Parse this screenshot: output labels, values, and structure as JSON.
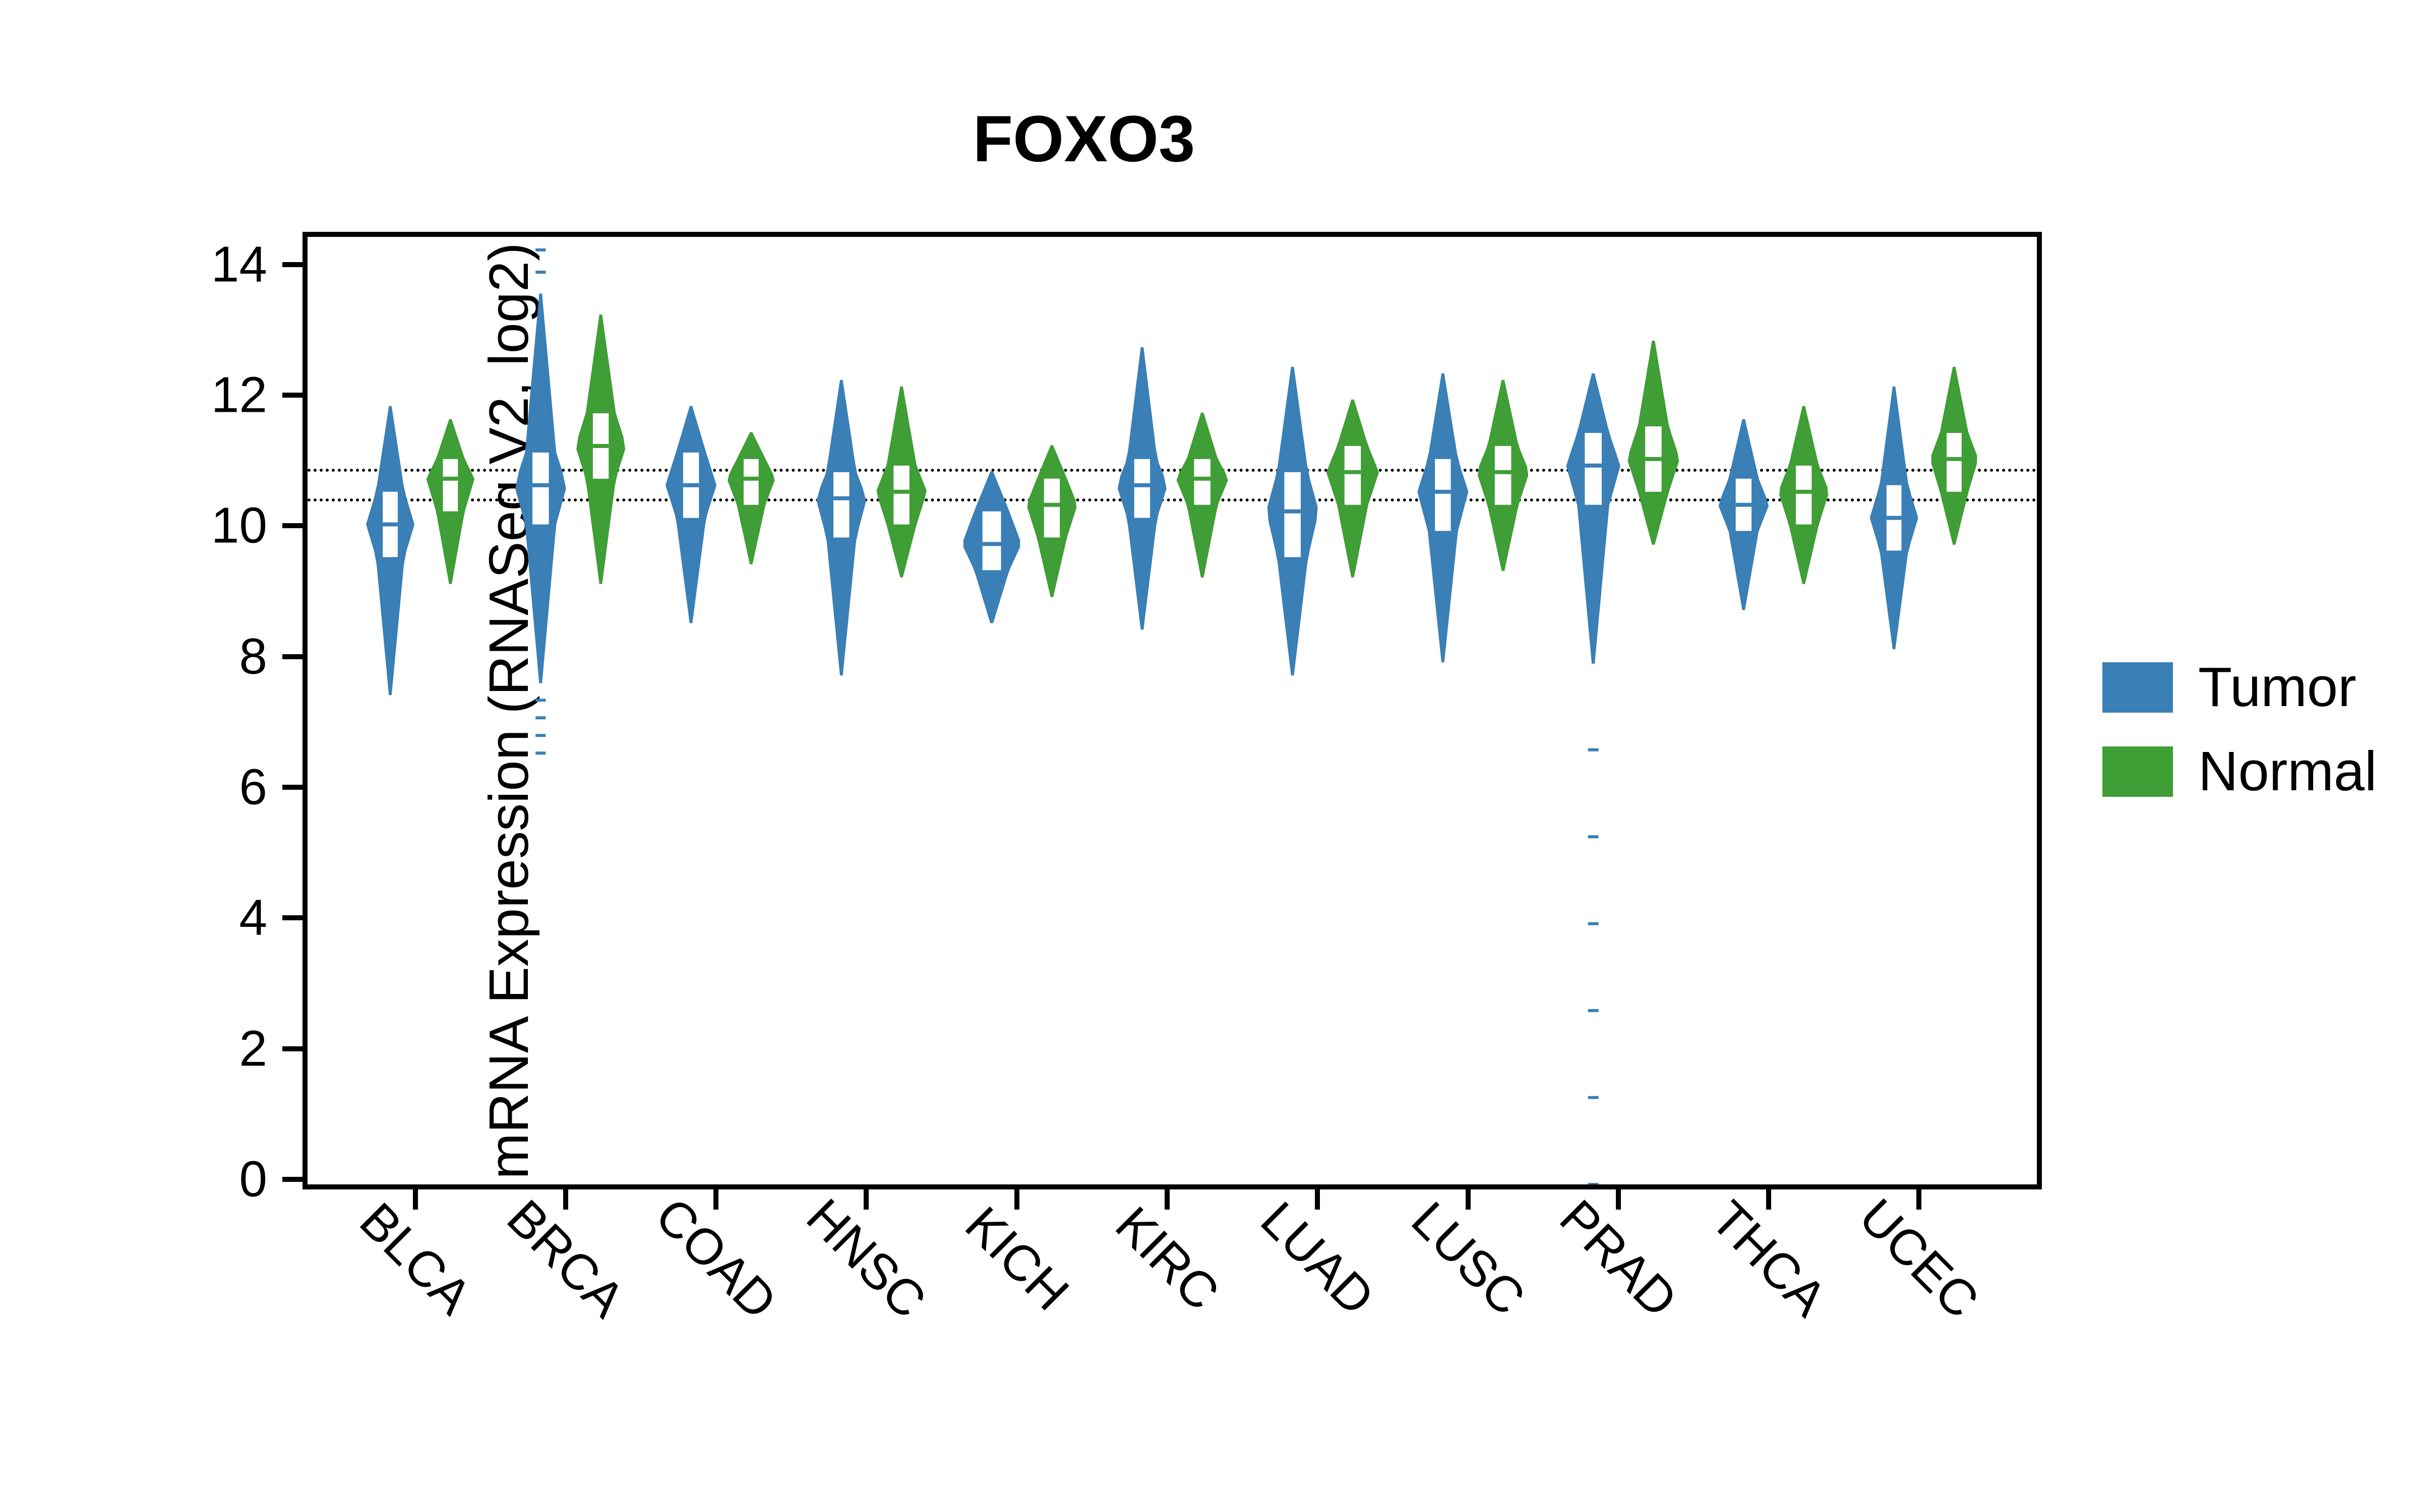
{
  "chart_data": {
    "type": "violin",
    "title": "FOXO3",
    "ylabel": "mRNA Expression (RNASeq V2, log2)",
    "xlabel": "",
    "ylim": [
      0,
      14.5
    ],
    "yticks": [
      0,
      2,
      4,
      6,
      8,
      10,
      12,
      14
    ],
    "reference_lines": [
      10.5,
      10.95
    ],
    "categories": [
      "BLCA",
      "BRCA",
      "COAD",
      "HNSC",
      "KICH",
      "KIRC",
      "LUAD",
      "LUSC",
      "PRAD",
      "THCA",
      "UCEC"
    ],
    "series": [
      {
        "name": "Tumor",
        "color": "#3a7fb5",
        "values": [
          {
            "median": 10.1,
            "q1": 9.6,
            "q3": 10.6,
            "min": 7.5,
            "max": 11.9,
            "width": 0.55
          },
          {
            "median": 10.7,
            "q1": 10.1,
            "q3": 11.2,
            "min": 6.6,
            "max": 14.3,
            "width": 0.6
          },
          {
            "median": 10.7,
            "q1": 10.2,
            "q3": 11.2,
            "min": 8.6,
            "max": 11.9,
            "width": 0.58
          },
          {
            "median": 10.5,
            "q1": 9.9,
            "q3": 10.9,
            "min": 7.8,
            "max": 12.3,
            "width": 0.58
          },
          {
            "median": 9.8,
            "q1": 9.4,
            "q3": 10.3,
            "min": 8.6,
            "max": 10.9,
            "width": 0.68
          },
          {
            "median": 10.7,
            "q1": 10.2,
            "q3": 11.1,
            "min": 8.5,
            "max": 12.8,
            "width": 0.58
          },
          {
            "median": 10.3,
            "q1": 9.6,
            "q3": 10.9,
            "min": 7.8,
            "max": 12.5,
            "width": 0.6
          },
          {
            "median": 10.6,
            "q1": 10.0,
            "q3": 11.1,
            "min": 8.0,
            "max": 12.4,
            "width": 0.58
          },
          {
            "median": 11.0,
            "q1": 10.4,
            "q3": 11.5,
            "min": 0.0,
            "max": 12.4,
            "width": 0.62
          },
          {
            "median": 10.4,
            "q1": 10.0,
            "q3": 10.8,
            "min": 8.8,
            "max": 11.7,
            "width": 0.58
          },
          {
            "median": 10.2,
            "q1": 9.7,
            "q3": 10.7,
            "min": 8.2,
            "max": 12.2,
            "width": 0.55
          }
        ]
      },
      {
        "name": "Normal",
        "color": "#3f9e35",
        "values": [
          {
            "median": 10.8,
            "q1": 10.3,
            "q3": 11.1,
            "min": 9.2,
            "max": 11.7,
            "width": 0.55
          },
          {
            "median": 11.3,
            "q1": 10.8,
            "q3": 11.8,
            "min": 9.2,
            "max": 13.3,
            "width": 0.58
          },
          {
            "median": 10.8,
            "q1": 10.4,
            "q3": 11.1,
            "min": 9.5,
            "max": 11.5,
            "width": 0.55
          },
          {
            "median": 10.6,
            "q1": 10.1,
            "q3": 11.0,
            "min": 9.3,
            "max": 12.2,
            "width": 0.58
          },
          {
            "median": 10.4,
            "q1": 9.9,
            "q3": 10.8,
            "min": 9.0,
            "max": 11.3,
            "width": 0.58
          },
          {
            "median": 10.8,
            "q1": 10.4,
            "q3": 11.1,
            "min": 9.3,
            "max": 11.8,
            "width": 0.6
          },
          {
            "median": 10.9,
            "q1": 10.4,
            "q3": 11.3,
            "min": 9.3,
            "max": 12.0,
            "width": 0.6
          },
          {
            "median": 10.9,
            "q1": 10.4,
            "q3": 11.3,
            "min": 9.4,
            "max": 12.3,
            "width": 0.6
          },
          {
            "median": 11.1,
            "q1": 10.6,
            "q3": 11.6,
            "min": 9.8,
            "max": 12.9,
            "width": 0.6
          },
          {
            "median": 10.6,
            "q1": 10.1,
            "q3": 11.0,
            "min": 9.2,
            "max": 11.9,
            "width": 0.58
          },
          {
            "median": 11.1,
            "q1": 10.6,
            "q3": 11.5,
            "min": 9.8,
            "max": 12.5,
            "width": 0.55
          }
        ]
      }
    ]
  },
  "legend": {
    "items": [
      {
        "label": "Tumor"
      },
      {
        "label": "Normal"
      }
    ]
  }
}
